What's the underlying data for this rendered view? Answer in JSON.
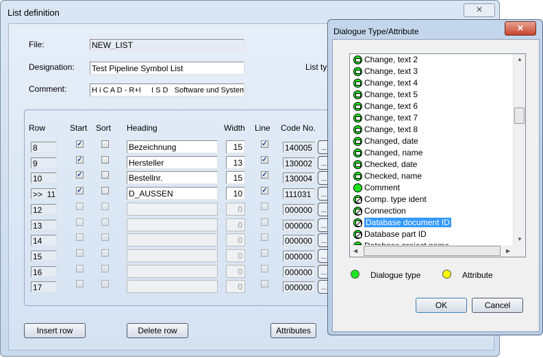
{
  "main": {
    "title": "List definition",
    "close": "✕",
    "file_label": "File:",
    "file_value": "NEW_LIST",
    "designation_label": "Designation:",
    "designation_value": "Test Pipeline Symbol List",
    "comment_label": "Comment:",
    "comment_value": "H i C A D - R+I     I S D   Software und System",
    "list_type_label": "List typ",
    "headers": {
      "row": "Row",
      "start": "Start",
      "sort": "Sort",
      "heading": "Heading",
      "width": "Width",
      "line": "Line",
      "code": "Code No."
    },
    "rows": [
      {
        "row": "8",
        "start": true,
        "sort": false,
        "heading": "Bezeichnung",
        "width": "15",
        "line": true,
        "code": "140005",
        "enabled": true
      },
      {
        "row": "9",
        "start": true,
        "sort": false,
        "heading": "Hersteller",
        "width": "13",
        "line": true,
        "code": "130002",
        "enabled": true
      },
      {
        "row": "10",
        "start": true,
        "sort": false,
        "heading": "Bestellnr.",
        "width": "15",
        "line": true,
        "code": "130004",
        "enabled": true
      },
      {
        "row": ">>  11",
        "start": true,
        "sort": false,
        "heading": "D_AUSSEN",
        "width": "10",
        "line": true,
        "code": "111031",
        "enabled": true
      },
      {
        "row": "12",
        "start": false,
        "sort": false,
        "heading": "",
        "width": "0",
        "line": false,
        "code": "000000",
        "enabled": false
      },
      {
        "row": "13",
        "start": false,
        "sort": false,
        "heading": "",
        "width": "0",
        "line": false,
        "code": "000000",
        "enabled": false
      },
      {
        "row": "14",
        "start": false,
        "sort": false,
        "heading": "",
        "width": "0",
        "line": false,
        "code": "000000",
        "enabled": false
      },
      {
        "row": "15",
        "start": false,
        "sort": false,
        "heading": "",
        "width": "0",
        "line": false,
        "code": "000000",
        "enabled": false
      },
      {
        "row": "16",
        "start": false,
        "sort": false,
        "heading": "",
        "width": "0",
        "line": false,
        "code": "000000",
        "enabled": false
      },
      {
        "row": "17",
        "start": false,
        "sort": false,
        "heading": "",
        "width": "0",
        "line": false,
        "code": "000000",
        "enabled": false
      }
    ],
    "code_button": "...",
    "insert_row": "Insert row",
    "delete_row": "Delete row",
    "attributes": "Attributes"
  },
  "dialog": {
    "title": "Dialogue Type/Attribute",
    "close": "✕",
    "items": [
      {
        "label": "Change, text 2",
        "icon": "doc"
      },
      {
        "label": "Change, text 3",
        "icon": "doc"
      },
      {
        "label": "Change, text 4",
        "icon": "doc"
      },
      {
        "label": "Change, text 5",
        "icon": "doc"
      },
      {
        "label": "Change, text 6",
        "icon": "doc"
      },
      {
        "label": "Change, text 7",
        "icon": "doc"
      },
      {
        "label": "Change, text 8",
        "icon": "doc"
      },
      {
        "label": "Changed, date",
        "icon": "doc"
      },
      {
        "label": "Changed, name",
        "icon": "doc"
      },
      {
        "label": "Checked, date",
        "icon": "doc"
      },
      {
        "label": "Checked, name",
        "icon": "doc"
      },
      {
        "label": "Comment",
        "icon": "plain"
      },
      {
        "label": "Comp. type ident",
        "icon": "edit"
      },
      {
        "label": "Connection",
        "icon": "edit"
      },
      {
        "label": "Database document ID",
        "icon": "edit",
        "selected": true
      },
      {
        "label": "Database part ID",
        "icon": "edit"
      },
      {
        "label": "Database project name",
        "icon": "doc"
      }
    ],
    "legend_dialogue": "Dialogue type",
    "legend_attribute": "Attribute",
    "colors": {
      "dialogue": "#1fe31f",
      "attribute": "#ffff00"
    },
    "ok": "OK",
    "cancel": "Cancel"
  }
}
